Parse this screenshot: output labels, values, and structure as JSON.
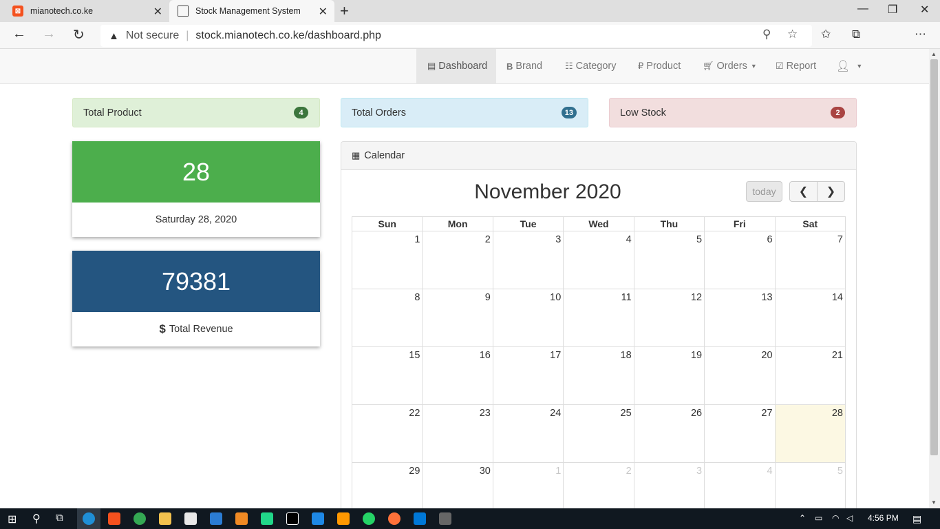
{
  "browser": {
    "tabs": [
      {
        "title": "mianotech.co.ke",
        "favicon": "xampp-icon"
      },
      {
        "title": "Stock Management System",
        "favicon": "page-icon"
      }
    ],
    "security_label": "Not secure",
    "url": "stock.mianotech.co.ke/dashboard.php"
  },
  "nav": {
    "items": [
      {
        "label": "Dashboard",
        "icon": "list-alt-icon",
        "active": true
      },
      {
        "label": "Brand",
        "icon": "bold-icon"
      },
      {
        "label": "Category",
        "icon": "th-list-icon"
      },
      {
        "label": "Product",
        "icon": "ruble-icon"
      },
      {
        "label": "Orders",
        "icon": "shopping-cart-icon",
        "dropdown": true
      },
      {
        "label": "Report",
        "icon": "check-icon"
      },
      {
        "label": "",
        "icon": "user-icon",
        "dropdown": true
      }
    ]
  },
  "stats": [
    {
      "label": "Total Product",
      "count": "4",
      "color": "#3c763d",
      "bg": "#dff0d8"
    },
    {
      "label": "Total Orders",
      "count": "13",
      "color": "#31708f",
      "bg": "#d9edf7"
    },
    {
      "label": "Low Stock",
      "count": "2",
      "color": "#a94442",
      "bg": "#f2dede"
    }
  ],
  "date_card": {
    "day": "28",
    "label": "Saturday 28, 2020",
    "color": "#4cae4c"
  },
  "revenue_card": {
    "value": "79381",
    "currency_symbol": "$",
    "label": "Total Revenue",
    "color": "#245580"
  },
  "calendar": {
    "panel_title": "Calendar",
    "month_title": "November 2020",
    "today_label": "today",
    "weekdays": [
      "Sun",
      "Mon",
      "Tue",
      "Wed",
      "Thu",
      "Fri",
      "Sat"
    ],
    "weeks": [
      [
        "1",
        "2",
        "3",
        "4",
        "5",
        "6",
        "7"
      ],
      [
        "8",
        "9",
        "10",
        "11",
        "12",
        "13",
        "14"
      ],
      [
        "15",
        "16",
        "17",
        "18",
        "19",
        "20",
        "21"
      ],
      [
        "22",
        "23",
        "24",
        "25",
        "26",
        "27",
        "28"
      ],
      [
        "29",
        "30",
        "1",
        "2",
        "3",
        "4",
        "5"
      ]
    ],
    "today": "28"
  },
  "taskbar": {
    "time": "4:56 PM"
  }
}
